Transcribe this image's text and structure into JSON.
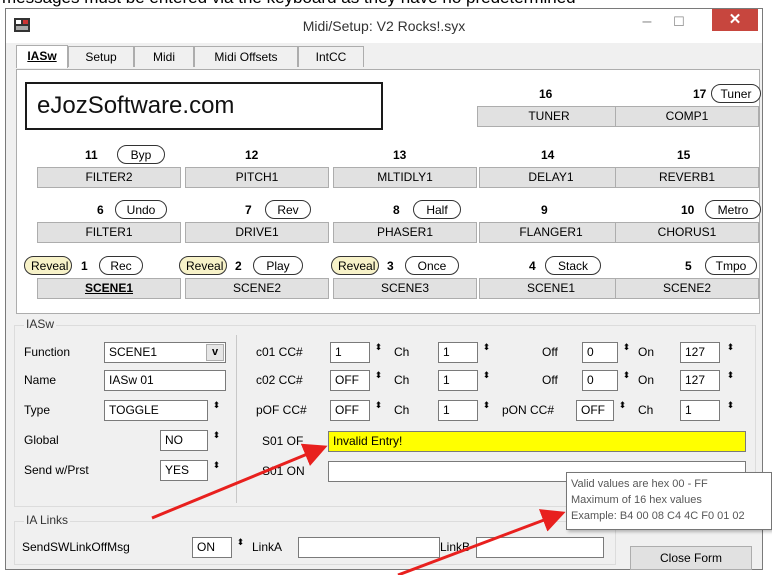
{
  "top_caption": "messages must be entered via the keyboard as they have no predetermined",
  "window": {
    "title": "Midi/Setup: V2 Rocks!.syx",
    "minimize": "–",
    "maximize": "☐",
    "close": "✕"
  },
  "tabs": [
    "IASw",
    "Setup",
    "Midi",
    "Midi Offsets",
    "IntCC"
  ],
  "logo_text": "eJozSoftware.com",
  "slots": {
    "s16": {
      "num": "16",
      "label": "TUNER"
    },
    "s17": {
      "num": "17",
      "tag": "Tuner",
      "label": "COMP1"
    },
    "s11": {
      "num": "11",
      "tag": "Byp",
      "label": "FILTER2"
    },
    "s12": {
      "num": "12",
      "label": "PITCH1"
    },
    "s13": {
      "num": "13",
      "label": "MLTIDLY1"
    },
    "s14": {
      "num": "14",
      "label": "DELAY1"
    },
    "s15": {
      "num": "15",
      "label": "REVERB1"
    },
    "s6": {
      "num": "6",
      "tag": "Undo",
      "label": "FILTER1"
    },
    "s7": {
      "num": "7",
      "tag": "Rev",
      "label": "DRIVE1"
    },
    "s8": {
      "num": "8",
      "tag": "Half",
      "label": "PHASER1"
    },
    "s9": {
      "num": "9",
      "label": "FLANGER1"
    },
    "s10": {
      "num": "10",
      "tag": "Metro",
      "label": "CHORUS1"
    },
    "s1": {
      "reveal": "Reveal",
      "num": "1",
      "tag": "Rec",
      "label": "SCENE1"
    },
    "s2": {
      "reveal": "Reveal",
      "num": "2",
      "tag": "Play",
      "label": "SCENE2"
    },
    "s3": {
      "reveal": "Reveal",
      "num": "3",
      "tag": "Once",
      "label": "SCENE3"
    },
    "s4": {
      "num": "4",
      "tag": "Stack",
      "label": "SCENE1"
    },
    "s5": {
      "num": "5",
      "tag": "Tmpo",
      "label": "SCENE2"
    }
  },
  "iasw": {
    "group_label": "IASw",
    "function_label": "Function",
    "function_value": "SCENE1",
    "function_dd": "v",
    "name_label": "Name",
    "name_value": "IASw 01",
    "type_label": "Type",
    "type_value": "TOGGLE",
    "global_label": "Global",
    "global_value": "NO",
    "sendprst_label": "Send w/Prst",
    "sendprst_value": "YES",
    "c01_label": "c01 CC#",
    "c01_value": "1",
    "c01_ch_label": "Ch",
    "c01_ch": "1",
    "c01_off_label": "Off",
    "c01_off": "0",
    "c01_on_label": "On",
    "c01_on": "127",
    "c02_label": "c02 CC#",
    "c02_value": "OFF",
    "c02_ch_label": "Ch",
    "c02_ch": "1",
    "c02_off_label": "Off",
    "c02_off": "0",
    "c02_on_label": "On",
    "c02_on": "127",
    "pof_label": "pOF CC#",
    "pof_value": "OFF",
    "pof_ch_label": "Ch",
    "pof_ch": "1",
    "pon_label": "pON CC#",
    "pon_value": "OFF",
    "pon_ch_label": "Ch",
    "pon_ch": "1",
    "s01of_label": "S01 OF",
    "s01of_value": "Invalid Entry!",
    "s01on_label": "S01 ON",
    "s01on_value": ""
  },
  "links": {
    "group_label": "IA Links",
    "sendsw_label": "SendSWLinkOffMsg",
    "sendsw_value": "ON",
    "linka_label": "LinkA",
    "linka_value": "",
    "linkb_label": "LinkB",
    "linkb_value": ""
  },
  "tooltip": {
    "line1": "Valid values are hex 00 - FF",
    "line2": "Maximum of 16 hex values",
    "line3": "Example: B4 00 08 C4 4C F0 01 02"
  },
  "close_form": "Close Form",
  "colors": {
    "error_bg": "#ffff00",
    "arrow": "#e8201e",
    "close_red": "#c7463e",
    "reveal_bg": "#f7f2c8"
  },
  "spinner_glyph": "⬍"
}
